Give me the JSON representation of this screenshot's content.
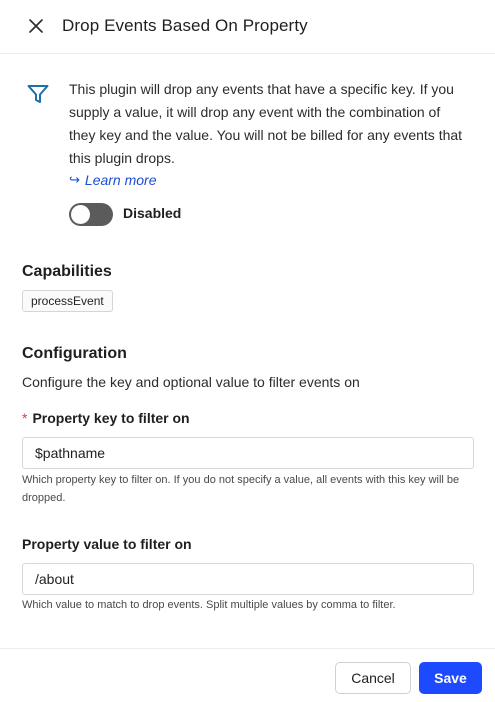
{
  "header": {
    "title": "Drop Events Based On Property",
    "close_icon": "close-icon"
  },
  "plugin": {
    "icon": "filter-icon",
    "accent_color": "#1d6fa8",
    "description": "This plugin will drop any events that have a specific key. If you supply a value, it will drop any event with the combination of they key and the value. You will not be billed for any events that this plugin drops.",
    "learn_more_label": "Learn more",
    "toggle_label": "Disabled",
    "toggle_on": false
  },
  "capabilities": {
    "heading": "Capabilities",
    "items": [
      "processEvent"
    ]
  },
  "configuration": {
    "heading": "Configuration",
    "description": "Configure the key and optional value to filter events on",
    "fields": [
      {
        "label": "Property key to filter on",
        "required": true,
        "value": "$pathname",
        "help": "Which property key to filter on. If you do not specify a value, all events with this key will be dropped."
      },
      {
        "label": "Property value to filter on",
        "required": false,
        "value": "/about",
        "help": "Which value to match to drop events. Split multiple values by comma to filter."
      }
    ]
  },
  "footer": {
    "cancel_label": "Cancel",
    "save_label": "Save",
    "primary_color": "#1d4aff"
  }
}
